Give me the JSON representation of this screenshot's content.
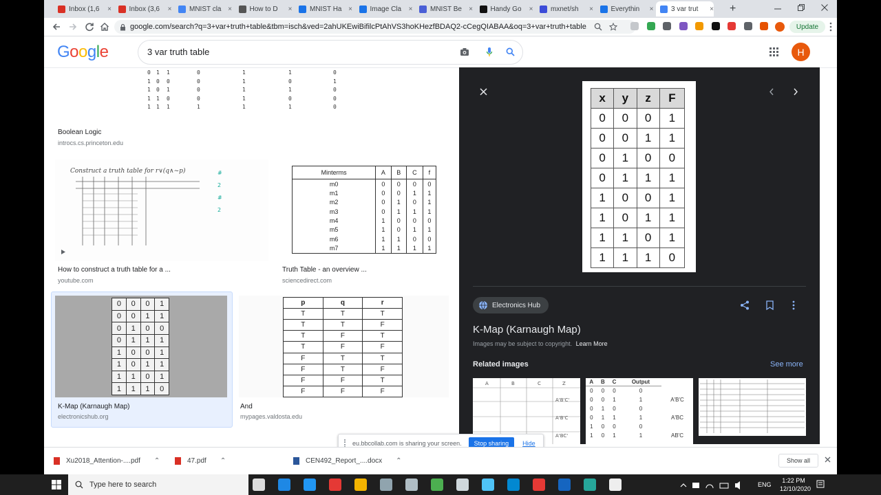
{
  "tabs": [
    {
      "label": "Inbox (1,6",
      "icon": "gmail-icon",
      "color": "#d93025"
    },
    {
      "label": "Inbox (3,6",
      "icon": "gmail-icon",
      "color": "#d93025"
    },
    {
      "label": "MNIST cla",
      "icon": "google-icon",
      "color": "#4285f4"
    },
    {
      "label": "How to D",
      "icon": "site-icon",
      "color": "#555555"
    },
    {
      "label": "MNIST Ha",
      "icon": "kaggle-icon",
      "color": "#1a73e8"
    },
    {
      "label": "Image Cla",
      "icon": "kaggle-icon",
      "color": "#1a73e8"
    },
    {
      "label": "MNIST Be",
      "icon": "site-icon",
      "color": "#4a5fd6"
    },
    {
      "label": "Handy Go",
      "icon": "site-icon",
      "color": "#111111"
    },
    {
      "label": "mxnet/sh",
      "icon": "site-icon",
      "color": "#3c4cd8"
    },
    {
      "label": "Everythin",
      "icon": "site-icon",
      "color": "#1a73e8"
    },
    {
      "label": "3 var trut",
      "icon": "google-icon",
      "color": "#4285f4"
    }
  ],
  "url": "google.com/search?q=3+var+truth+table&tbm=isch&ved=2ahUKEwiBifilcPtAhVS3hoKHezfBDAQ2-cCegQIABAA&oq=3+var+truth+table...",
  "update_label": "Update",
  "google": {
    "logo": "Google",
    "query": "3 var truth table",
    "avatar": "H"
  },
  "results": {
    "r1": {
      "title": "Boolean Logic",
      "source": "introcs.cs.princeton.edu",
      "rows": [
        [
          "0",
          "1",
          "1",
          "0",
          "1",
          "1",
          "0"
        ],
        [
          "1",
          "0",
          "0",
          "0",
          "1",
          "0",
          "1"
        ],
        [
          "1",
          "0",
          "1",
          "0",
          "1",
          "1",
          "0"
        ],
        [
          "1",
          "1",
          "0",
          "0",
          "1",
          "0",
          "0"
        ],
        [
          "1",
          "1",
          "1",
          "1",
          "1",
          "1",
          "0"
        ]
      ]
    },
    "r2": {
      "title": "How to construct a truth table for a ...",
      "source": "youtube.com",
      "note": "Construct a truth table for r∨(q∧~p)"
    },
    "r3": {
      "title": "Truth Table - an overview ...",
      "source": "sciencedirect.com",
      "headers": [
        "Minterms",
        "A",
        "B",
        "C",
        "f"
      ],
      "rows": [
        [
          "m0",
          "0",
          "0",
          "0",
          "0"
        ],
        [
          "m1",
          "0",
          "0",
          "1",
          "1"
        ],
        [
          "m2",
          "0",
          "1",
          "0",
          "1"
        ],
        [
          "m3",
          "0",
          "1",
          "1",
          "1"
        ],
        [
          "m4",
          "1",
          "0",
          "0",
          "0"
        ],
        [
          "m5",
          "1",
          "0",
          "1",
          "1"
        ],
        [
          "m6",
          "1",
          "1",
          "0",
          "0"
        ],
        [
          "m7",
          "1",
          "1",
          "1",
          "1"
        ]
      ]
    },
    "r4": {
      "title": "K-Map (Karnaugh Map)",
      "source": "electronicshub.org",
      "rows": [
        [
          "0",
          "0",
          "0",
          "1"
        ],
        [
          "0",
          "0",
          "1",
          "1"
        ],
        [
          "0",
          "1",
          "0",
          "0"
        ],
        [
          "0",
          "1",
          "1",
          "1"
        ],
        [
          "1",
          "0",
          "0",
          "1"
        ],
        [
          "1",
          "0",
          "1",
          "1"
        ],
        [
          "1",
          "1",
          "0",
          "1"
        ],
        [
          "1",
          "1",
          "1",
          "0"
        ]
      ]
    },
    "r5": {
      "title": "And",
      "source": "mypages.valdosta.edu",
      "headers": [
        "p",
        "q",
        "r"
      ],
      "rows": [
        [
          "T",
          "T",
          "T"
        ],
        [
          "T",
          "T",
          "F"
        ],
        [
          "T",
          "F",
          "T"
        ],
        [
          "T",
          "F",
          "F"
        ],
        [
          "F",
          "T",
          "T"
        ],
        [
          "F",
          "T",
          "F"
        ],
        [
          "F",
          "F",
          "T"
        ],
        [
          "F",
          "F",
          "F"
        ]
      ]
    }
  },
  "panel": {
    "source": "Electronics Hub",
    "title": "K-Map (Karnaugh Map)",
    "copyright": "Images may be subject to copyright.",
    "learn_more": "Learn More",
    "related": "Related images",
    "see_more": "See more",
    "table_headers": [
      "x",
      "y",
      "z",
      "F"
    ],
    "table_rows": [
      [
        "0",
        "0",
        "0",
        "1"
      ],
      [
        "0",
        "0",
        "1",
        "1"
      ],
      [
        "0",
        "1",
        "0",
        "0"
      ],
      [
        "0",
        "1",
        "1",
        "1"
      ],
      [
        "1",
        "0",
        "0",
        "1"
      ],
      [
        "1",
        "0",
        "1",
        "1"
      ],
      [
        "1",
        "1",
        "0",
        "1"
      ],
      [
        "1",
        "1",
        "1",
        "0"
      ]
    ],
    "rel2_headers": [
      "A",
      "B",
      "C",
      "Output"
    ],
    "rel2_rows": [
      [
        "0",
        "0",
        "0",
        "0",
        ""
      ],
      [
        "0",
        "0",
        "1",
        "1",
        "A'B'C"
      ],
      [
        "0",
        "1",
        "0",
        "0",
        ""
      ],
      [
        "0",
        "1",
        "1",
        "1",
        "A'BC"
      ],
      [
        "1",
        "0",
        "0",
        "0",
        ""
      ],
      [
        "1",
        "0",
        "1",
        "1",
        "AB'C"
      ]
    ]
  },
  "share": {
    "text": "eu.bbcollab.com is sharing your screen.",
    "stop": "Stop sharing",
    "hide": "Hide"
  },
  "downloads": [
    {
      "name": "Xu2018_Attention-....pdf",
      "color": "#d93025"
    },
    {
      "name": "47.pdf",
      "color": "#d93025"
    },
    {
      "name": "CEN492_Report_....docx",
      "color": "#2b579a"
    }
  ],
  "show_all": "Show all",
  "taskbar": {
    "search_placeholder": "Type here to search",
    "time": "1:22 PM",
    "date": "12/10/2020",
    "lang": "ENG"
  }
}
